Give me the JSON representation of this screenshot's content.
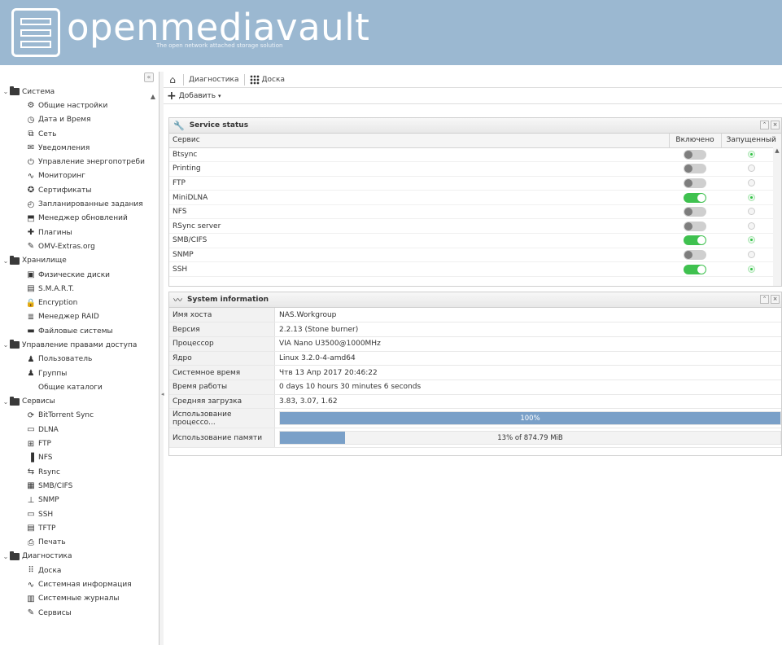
{
  "header": {
    "logo_name": "openmediavault",
    "logo_tagline": "The open network attached storage solution"
  },
  "sidebar": {
    "items": [
      {
        "label": "Система",
        "level": 0,
        "icon": "folder-icon"
      },
      {
        "label": "Общие настройки",
        "level": 1,
        "icon": "settings-icon"
      },
      {
        "label": "Дата и Время",
        "level": 1,
        "icon": "clock-icon"
      },
      {
        "label": "Сеть",
        "level": 1,
        "icon": "network-icon"
      },
      {
        "label": "Уведомления",
        "level": 1,
        "icon": "mail-icon"
      },
      {
        "label": "Управление энергопотреби",
        "level": 1,
        "icon": "power-icon"
      },
      {
        "label": "Мониторинг",
        "level": 1,
        "icon": "monitor-chart-icon"
      },
      {
        "label": "Сертификаты",
        "level": 1,
        "icon": "certificate-icon"
      },
      {
        "label": "Запланированные задания",
        "level": 1,
        "icon": "scheduler-icon"
      },
      {
        "label": "Менеджер обновлений",
        "level": 1,
        "icon": "update-icon"
      },
      {
        "label": "Плагины",
        "level": 1,
        "icon": "plugin-icon"
      },
      {
        "label": "OMV-Extras.org",
        "level": 1,
        "icon": "wrench-icon"
      },
      {
        "label": "Хранилище",
        "level": 0,
        "icon": "folder-icon"
      },
      {
        "label": "Физические диски",
        "level": 1,
        "icon": "disk-icon"
      },
      {
        "label": "S.M.A.R.T.",
        "level": 1,
        "icon": "smart-icon"
      },
      {
        "label": "Encryption",
        "level": 1,
        "icon": "lock-icon"
      },
      {
        "label": "Менеджер RAID",
        "level": 1,
        "icon": "raid-icon"
      },
      {
        "label": "Файловые системы",
        "level": 1,
        "icon": "filesystem-icon"
      },
      {
        "label": "Управление правами доступа",
        "level": 0,
        "icon": "folder-icon"
      },
      {
        "label": "Пользователь",
        "level": 1,
        "icon": "user-icon"
      },
      {
        "label": "Группы",
        "level": 1,
        "icon": "group-icon"
      },
      {
        "label": "Общие каталоги",
        "level": 1,
        "icon": "shared-folder-icon"
      },
      {
        "label": "Сервисы",
        "level": 0,
        "icon": "folder-icon"
      },
      {
        "label": "BitTorrent Sync",
        "level": 1,
        "icon": "sync-icon"
      },
      {
        "label": "DLNA",
        "level": 1,
        "icon": "dlna-icon"
      },
      {
        "label": "FTP",
        "level": 1,
        "icon": "ftp-icon"
      },
      {
        "label": "NFS",
        "level": 1,
        "icon": "nfs-icon"
      },
      {
        "label": "Rsync",
        "level": 1,
        "icon": "rsync-icon"
      },
      {
        "label": "SMB/CIFS",
        "level": 1,
        "icon": "smb-icon"
      },
      {
        "label": "SNMP",
        "level": 1,
        "icon": "snmp-icon"
      },
      {
        "label": "SSH",
        "level": 1,
        "icon": "terminal-icon"
      },
      {
        "label": "TFTP",
        "level": 1,
        "icon": "tftp-icon"
      },
      {
        "label": "Печать",
        "level": 1,
        "icon": "printer-icon"
      },
      {
        "label": "Диагностика",
        "level": 0,
        "icon": "folder-icon"
      },
      {
        "label": "Доска",
        "level": 1,
        "icon": "dashboard-icon"
      },
      {
        "label": "Системная информация",
        "level": 1,
        "icon": "monitor-chart-icon"
      },
      {
        "label": "Системные журналы",
        "level": 1,
        "icon": "logs-icon"
      },
      {
        "label": "Сервисы",
        "level": 1,
        "icon": "wrench-icon"
      }
    ]
  },
  "breadcrumb": {
    "items": [
      "Диагностика",
      "Доска"
    ]
  },
  "toolbar": {
    "add_label": "Добавить"
  },
  "service_status": {
    "title": "Service status",
    "columns": [
      "Сервис",
      "Включено",
      "Запущенный"
    ],
    "rows": [
      {
        "name": "Btsync",
        "enabled": false,
        "running": true
      },
      {
        "name": "Printing",
        "enabled": false,
        "running": false
      },
      {
        "name": "FTP",
        "enabled": false,
        "running": false
      },
      {
        "name": "MiniDLNA",
        "enabled": true,
        "running": true
      },
      {
        "name": "NFS",
        "enabled": false,
        "running": false
      },
      {
        "name": "RSync server",
        "enabled": false,
        "running": false
      },
      {
        "name": "SMB/CIFS",
        "enabled": true,
        "running": true
      },
      {
        "name": "SNMP",
        "enabled": false,
        "running": false
      },
      {
        "name": "SSH",
        "enabled": true,
        "running": true
      }
    ]
  },
  "system_information": {
    "title": "System information",
    "rows": [
      {
        "key": "Имя хоста",
        "value": "NAS.Workgroup"
      },
      {
        "key": "Версия",
        "value": "2.2.13 (Stone burner)"
      },
      {
        "key": "Процессор",
        "value": "VIA Nano U3500@1000MHz"
      },
      {
        "key": "Ядро",
        "value": "Linux 3.2.0-4-amd64"
      },
      {
        "key": "Системное время",
        "value": "Чтв 13 Апр 2017 20:46:22"
      },
      {
        "key": "Время работы",
        "value": "0 days 10 hours 30 minutes 6 seconds"
      },
      {
        "key": "Средняя загрузка",
        "value": "3.83, 3.07, 1.62"
      }
    ],
    "cpu_usage": {
      "label": "Использование процессо...",
      "text": "100%",
      "fraction": 1.0
    },
    "memory_usage": {
      "label": "Использование памяти",
      "text": "13% of 874.79 MiB",
      "fraction": 0.13
    }
  },
  "colors": {
    "header_bg": "#9bb8d1",
    "progress_fill": "#7aa0c8",
    "toggle_on": "#3fc14f"
  }
}
